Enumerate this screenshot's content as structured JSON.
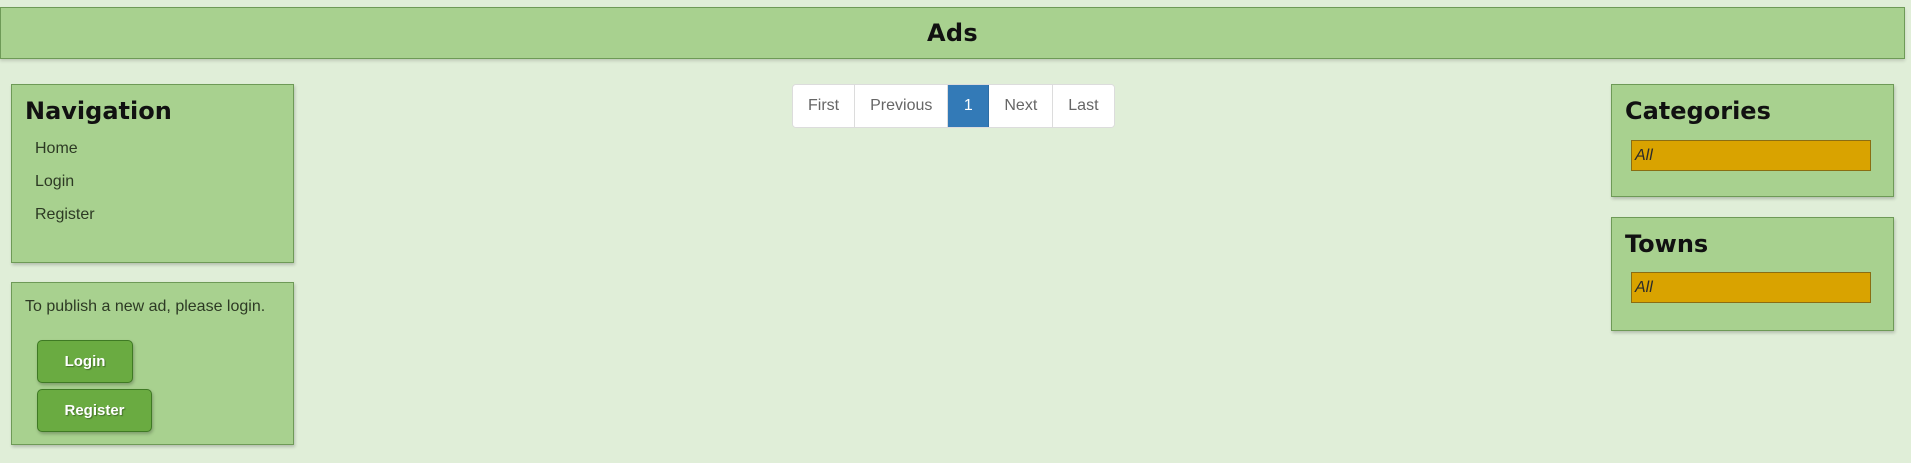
{
  "header": {
    "title": "Ads"
  },
  "navigation": {
    "title": "Navigation",
    "items": [
      {
        "label": "Home"
      },
      {
        "label": "Login"
      },
      {
        "label": "Register"
      }
    ]
  },
  "publish": {
    "message": "To publish a new ad, please login.",
    "login_label": "Login",
    "register_label": "Register"
  },
  "pagination": {
    "first": "First",
    "previous": "Previous",
    "current": "1",
    "next": "Next",
    "last": "Last"
  },
  "categories": {
    "title": "Categories",
    "selected": "All"
  },
  "towns": {
    "title": "Towns",
    "selected": "All"
  },
  "colors": {
    "background": "#e0eed8",
    "panel": "#a8d18f",
    "button": "#6aab41",
    "filter_highlight": "#d9a300",
    "pagination_active": "#337ab7"
  }
}
